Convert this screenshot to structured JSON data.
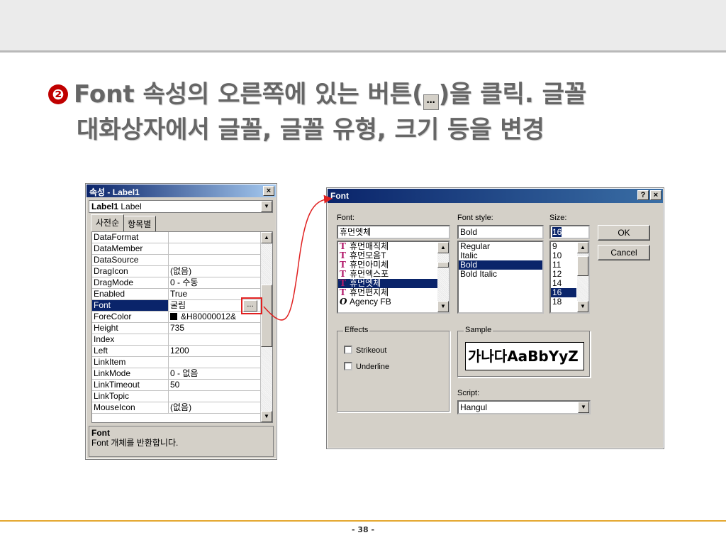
{
  "slide": {
    "bullet": "❷",
    "title_part1": "Font 속성의 오른쪽에 있는 버튼(",
    "title_ellipsis": "…",
    "title_part2": ")을 클릭. 글꼴",
    "title_line2": "대화상자에서 글꼴, 글꼴 유형, 크기 등을 변경",
    "page_number": "- 38 -"
  },
  "properties": {
    "title": "속성 - Label1",
    "close": "×",
    "object_bold": "Label1",
    "object_type": "Label",
    "tabs": [
      "사전순",
      "항목별"
    ],
    "rows": [
      {
        "name": "DataFormat",
        "value": ""
      },
      {
        "name": "DataMember",
        "value": ""
      },
      {
        "name": "DataSource",
        "value": ""
      },
      {
        "name": "DragIcon",
        "value": "(없음)"
      },
      {
        "name": "DragMode",
        "value": "0 - 수동"
      },
      {
        "name": "Enabled",
        "value": "True"
      },
      {
        "name": "Font",
        "value": "굴림"
      },
      {
        "name": "ForeColor",
        "value": "&H80000012&"
      },
      {
        "name": "Height",
        "value": "735"
      },
      {
        "name": "Index",
        "value": ""
      },
      {
        "name": "Left",
        "value": "1200"
      },
      {
        "name": "LinkItem",
        "value": ""
      },
      {
        "name": "LinkMode",
        "value": "0 - 없음"
      },
      {
        "name": "LinkTimeout",
        "value": "50"
      },
      {
        "name": "LinkTopic",
        "value": ""
      },
      {
        "name": "MouseIcon",
        "value": "(없음)"
      }
    ],
    "ellipsis": "...",
    "desc_title": "Font",
    "desc_text": "Font 개체를 반환합니다."
  },
  "font_dialog": {
    "title": "Font",
    "help": "?",
    "close": "×",
    "font_label": "Font:",
    "font_value": "휴먼엣체",
    "fonts": [
      "휴먼매직체",
      "휴먼모음T",
      "휴먼아미체",
      "휴먼엑스포",
      "휴먼엣체",
      "휴먼편지체",
      "Agency FB"
    ],
    "style_label": "Font style:",
    "style_value": "Bold",
    "styles": [
      "Regular",
      "Italic",
      "Bold",
      "Bold Italic"
    ],
    "size_label": "Size:",
    "size_value": "16",
    "sizes": [
      "9",
      "10",
      "11",
      "12",
      "14",
      "16",
      "18"
    ],
    "ok": "OK",
    "cancel": "Cancel",
    "effects_label": "Effects",
    "strikeout": "Strikeout",
    "underline": "Underline",
    "sample_label": "Sample",
    "sample_text": "가나다AaBbYyZ",
    "script_label": "Script:",
    "script_value": "Hangul"
  },
  "colors": {
    "accent_red": "#e02020",
    "caption_blue": "#0a246a",
    "footer_gold": "#e4a830"
  }
}
